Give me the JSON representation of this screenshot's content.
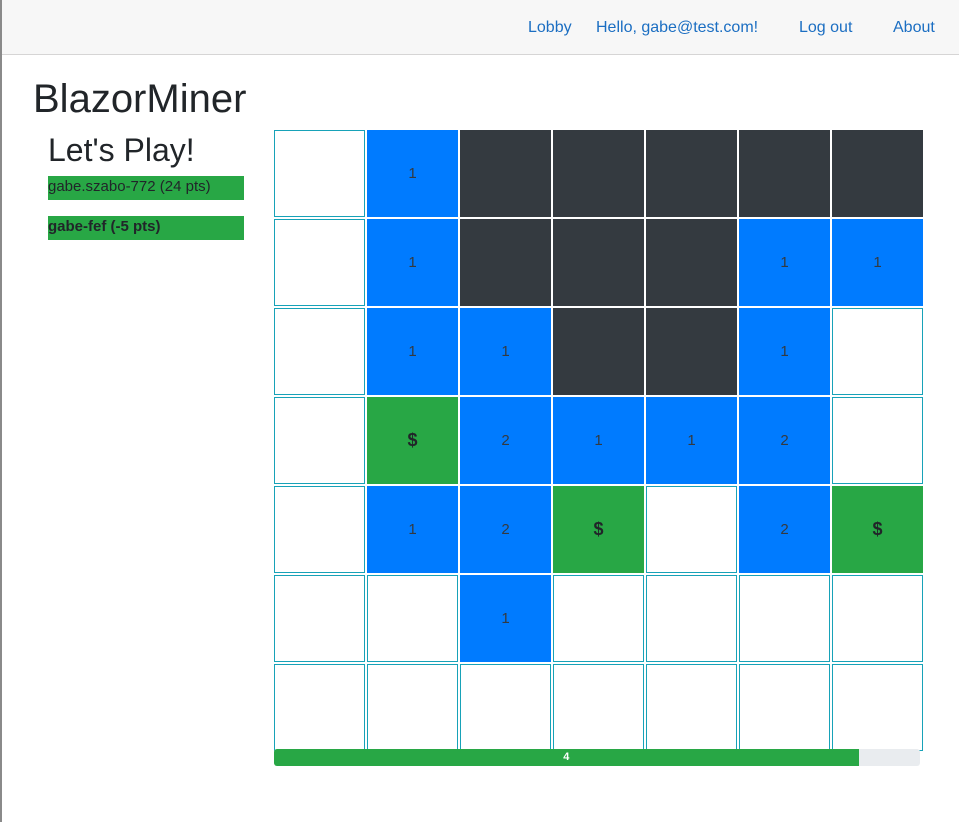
{
  "nav": {
    "lobby": "Lobby",
    "greeting": "Hello, gabe@test.com!",
    "logout": "Log out",
    "about": "About"
  },
  "app_title": "BlazorMiner",
  "subtitle": "Let's Play!",
  "players": [
    {
      "label": "gabe.szabo-772 (24 pts)",
      "current": false
    },
    {
      "label": "gabe-fef (-5 pts)",
      "current": true
    }
  ],
  "board": {
    "rows": [
      [
        "open",
        "1",
        "hidden",
        "hidden",
        "hidden",
        "hidden",
        "hidden"
      ],
      [
        "open",
        "1",
        "hidden",
        "hidden",
        "hidden",
        "1",
        "1"
      ],
      [
        "open",
        "1",
        "1",
        "hidden",
        "hidden",
        "1",
        "open"
      ],
      [
        "open",
        "$",
        "2",
        "1",
        "1",
        "2",
        "open"
      ],
      [
        "open",
        "1",
        "2",
        "$",
        "open",
        "2",
        "$"
      ],
      [
        "open",
        "open",
        "1",
        "open",
        "open",
        "open",
        "open"
      ],
      [
        "open",
        "open",
        "open",
        "open",
        "open",
        "open",
        "open"
      ]
    ]
  },
  "progress": {
    "label": "4",
    "fraction": 0.905
  },
  "colors": {
    "hidden": "#343a40",
    "number": "#007bff",
    "mine": "#28a745",
    "open_border": "#17a2b8",
    "link": "#1b6ec2"
  }
}
